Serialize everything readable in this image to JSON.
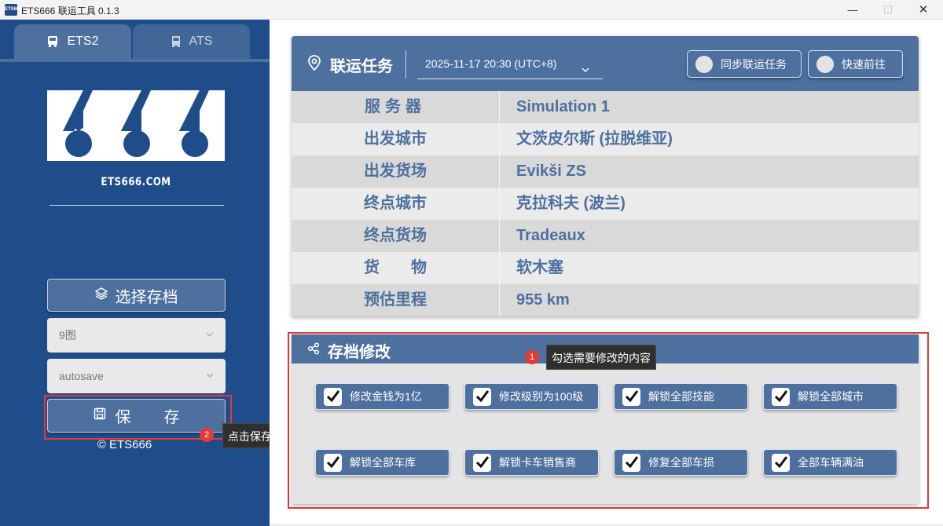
{
  "window": {
    "title": "ETS666 联运工具 0.1.3",
    "app_icon_text": "ETS666",
    "min_glyph": "—",
    "max_glyph": "☐",
    "close_glyph": "✕"
  },
  "sidebar": {
    "tabs": [
      {
        "label": "ETS2",
        "icon": "truck-icon"
      },
      {
        "label": "ATS",
        "icon": "truck-front-icon"
      }
    ],
    "logo_text": "ETS666.COM",
    "select_save_label": "选择存档",
    "profile_select": "9图",
    "save_select": "autosave",
    "save_button_label": "保存",
    "copyright": "© ETS666"
  },
  "callouts": [
    {
      "number": "1",
      "text": "勾选需要修改的内容"
    },
    {
      "number": "2",
      "text": "点击保存"
    }
  ],
  "task": {
    "title": "联运任务",
    "datetime": "2025-11-17 20:30 (UTC+8)",
    "sync_label": "同步联运任务",
    "go_label": "快速前往",
    "rows": [
      {
        "key": "服务器",
        "value": "Simulation 1"
      },
      {
        "key": "出发城市",
        "value": "文茨皮尔斯 (拉脱维亚)"
      },
      {
        "key": "出发货场",
        "value": "Evikši ZS"
      },
      {
        "key": "终点城市",
        "value": "克拉科夫 (波兰)"
      },
      {
        "key": "终点货场",
        "value": "Tradeaux"
      },
      {
        "key": "货物",
        "value": "软木塞"
      },
      {
        "key": "预估里程",
        "value": "955 km"
      }
    ]
  },
  "modify": {
    "title": "存档修改",
    "options": [
      {
        "label": "修改金钱为1亿",
        "checked": true
      },
      {
        "label": "修改级别为100级",
        "checked": true
      },
      {
        "label": "解锁全部技能",
        "checked": true
      },
      {
        "label": "解锁全部城市",
        "checked": true
      },
      {
        "label": "解锁全部车库",
        "checked": true
      },
      {
        "label": "解锁卡车销售商",
        "checked": true
      },
      {
        "label": "修复全部车损",
        "checked": true
      },
      {
        "label": "全部车辆满油",
        "checked": true
      }
    ]
  },
  "colors": {
    "sidebar_bg": "#1f4d89",
    "accent": "#4d709f",
    "highlight_frame": "#e33a3a",
    "badge": "#e53935"
  }
}
